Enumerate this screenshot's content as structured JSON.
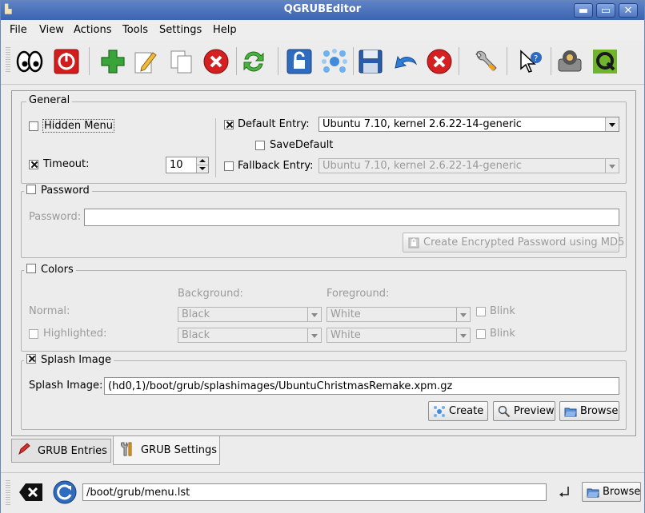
{
  "window": {
    "title": "QGRUBEditor",
    "buttons": {
      "minimize": "▬",
      "maximize": "▭",
      "close": "✕"
    }
  },
  "menu": [
    "File",
    "View",
    "Actions",
    "Tools",
    "Settings",
    "Help"
  ],
  "toolbar": {
    "icons": [
      "eyes-icon",
      "power-icon",
      "add-icon",
      "edit-icon",
      "copy-icon",
      "remove-icon",
      "refresh-icon",
      "lock-icon",
      "molecule-icon",
      "save-icon",
      "undo-icon",
      "cancel-icon",
      "wrench-icon",
      "whats-this-icon",
      "disk-icon",
      "qt-icon"
    ]
  },
  "general": {
    "title": "General",
    "hidden_menu": {
      "label": "Hidden Menu",
      "checked": false
    },
    "timeout": {
      "label": "Timeout:",
      "checked": true,
      "value": "10"
    },
    "default_entry": {
      "label": "Default Entry:",
      "checked": true,
      "value": "Ubuntu 7.10, kernel 2.6.22-14-generic"
    },
    "save_default": {
      "label": "SaveDefault",
      "checked": false
    },
    "fallback_entry": {
      "label": "Fallback Entry:",
      "checked": false,
      "value": "Ubuntu 7.10, kernel 2.6.22-14-generic"
    }
  },
  "password": {
    "title": "Password",
    "checked": false,
    "field_label": "Password:",
    "value": "",
    "md5_button": "Create Encrypted Password using MD5"
  },
  "colors": {
    "title": "Colors",
    "checked": false,
    "background_label": "Background:",
    "foreground_label": "Foreground:",
    "normal": {
      "label": "Normal:",
      "background": "Black",
      "foreground": "White",
      "blink": "Blink"
    },
    "highlighted": {
      "label": "Highlighted:",
      "background": "Black",
      "foreground": "White",
      "blink": "Blink"
    }
  },
  "splash": {
    "title": "Splash Image",
    "checked": true,
    "field_label": "Splash Image:",
    "value": "(hd0,1)/boot/grub/splashimages/UbuntuChristmasRemake.xpm.gz",
    "create": "Create",
    "preview": "Preview",
    "browse": "Browse"
  },
  "tabs": [
    "GRUB Entries",
    "GRUB Settings"
  ],
  "bottom": {
    "path": "/boot/grub/menu.lst",
    "browse": "Browse"
  },
  "colors_palette": {
    "titlebar": "#4a70b9",
    "accent_green": "#3aa33a",
    "danger_red": "#d42020"
  }
}
